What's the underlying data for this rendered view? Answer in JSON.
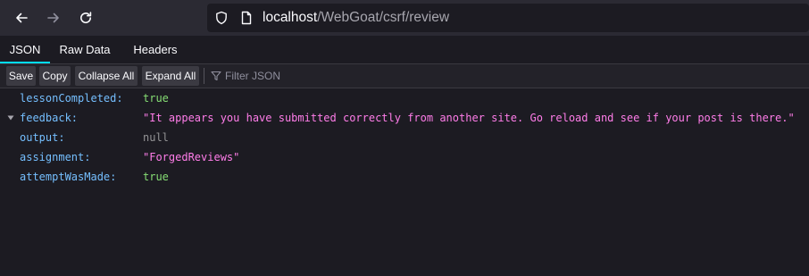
{
  "browser": {
    "url": {
      "host": "localhost",
      "path": "/WebGoat/csrf/review"
    }
  },
  "tabs": [
    {
      "label": "JSON",
      "active": true
    },
    {
      "label": "Raw Data",
      "active": false
    },
    {
      "label": "Headers",
      "active": false
    }
  ],
  "toolbar": {
    "save_label": "Save",
    "copy_label": "Copy",
    "collapse_label": "Collapse All",
    "expand_label": "Expand All",
    "filter_placeholder": "Filter JSON"
  },
  "json_rows": [
    {
      "key": "lessonCompleted:",
      "value": "true",
      "type": "bool"
    },
    {
      "key": "feedback:",
      "value": "\"It appears you have submitted correctly from another site. Go reload and see if your post is there.\"",
      "type": "string",
      "expanded": true
    },
    {
      "key": "output:",
      "value": "null",
      "type": "null"
    },
    {
      "key": "assignment:",
      "value": "\"ForgedReviews\"",
      "type": "string"
    },
    {
      "key": "attemptWasMade:",
      "value": "true",
      "type": "bool"
    }
  ],
  "colors": {
    "key": "#75bfff",
    "bool": "#86de74",
    "string": "#ff7de9",
    "null": "#939395",
    "active_tab_underline": "#00ddff"
  }
}
